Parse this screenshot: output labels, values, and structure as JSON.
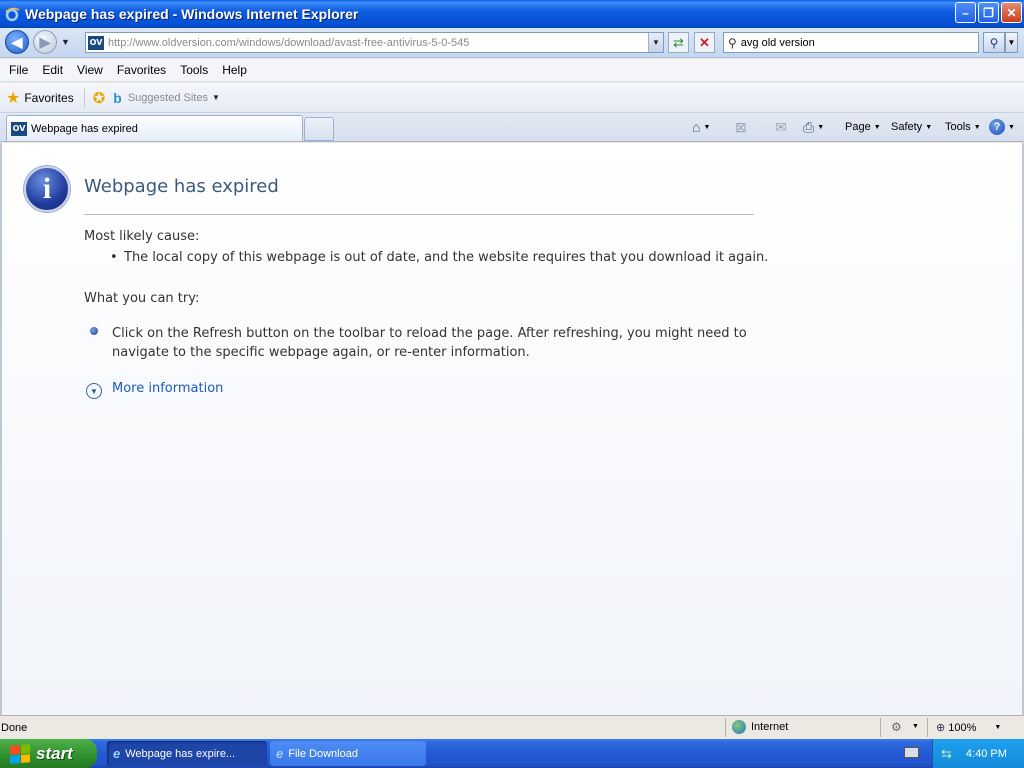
{
  "window": {
    "title": "Webpage has expired - Windows Internet Explorer",
    "minimize": "–",
    "maximize": "❐",
    "close": "✕"
  },
  "address": {
    "favicon_text": "OV",
    "url": "http://www.oldversion.com/windows/download/avast-free-antivirus-5-0-545",
    "search_value": "avg old version"
  },
  "menu": [
    "File",
    "Edit",
    "View",
    "Favorites",
    "Tools",
    "Help"
  ],
  "favorites_bar": {
    "favorites_label": "Favorites",
    "suggested_sites": "Suggested Sites"
  },
  "tab": {
    "label": "Webpage has expired"
  },
  "commands": {
    "page": "Page",
    "safety": "Safety",
    "tools": "Tools",
    "help": "?"
  },
  "content": {
    "heading": "Webpage has expired",
    "cause_label": "Most likely cause:",
    "cause_item": "The local copy of this webpage is out of date, and the website requires that you download it again.",
    "try_label": "What you can try:",
    "try_line1": "Click on the Refresh button on the toolbar to reload the page. After refreshing, you might need to",
    "try_line2": "navigate to the specific webpage again, or re-enter information.",
    "more_info": "More information"
  },
  "status": {
    "text": "Done",
    "zone": "Internet",
    "zoom": "100%"
  },
  "taskbar": {
    "start": "start",
    "items": [
      "Webpage has expire...",
      "File Download"
    ],
    "clock": "4:40 PM"
  },
  "colors": {
    "titlebar": "#0550d4",
    "heading": "#3b5a7e",
    "link": "#1c5bb5",
    "start_green": "#2f8f2c"
  }
}
